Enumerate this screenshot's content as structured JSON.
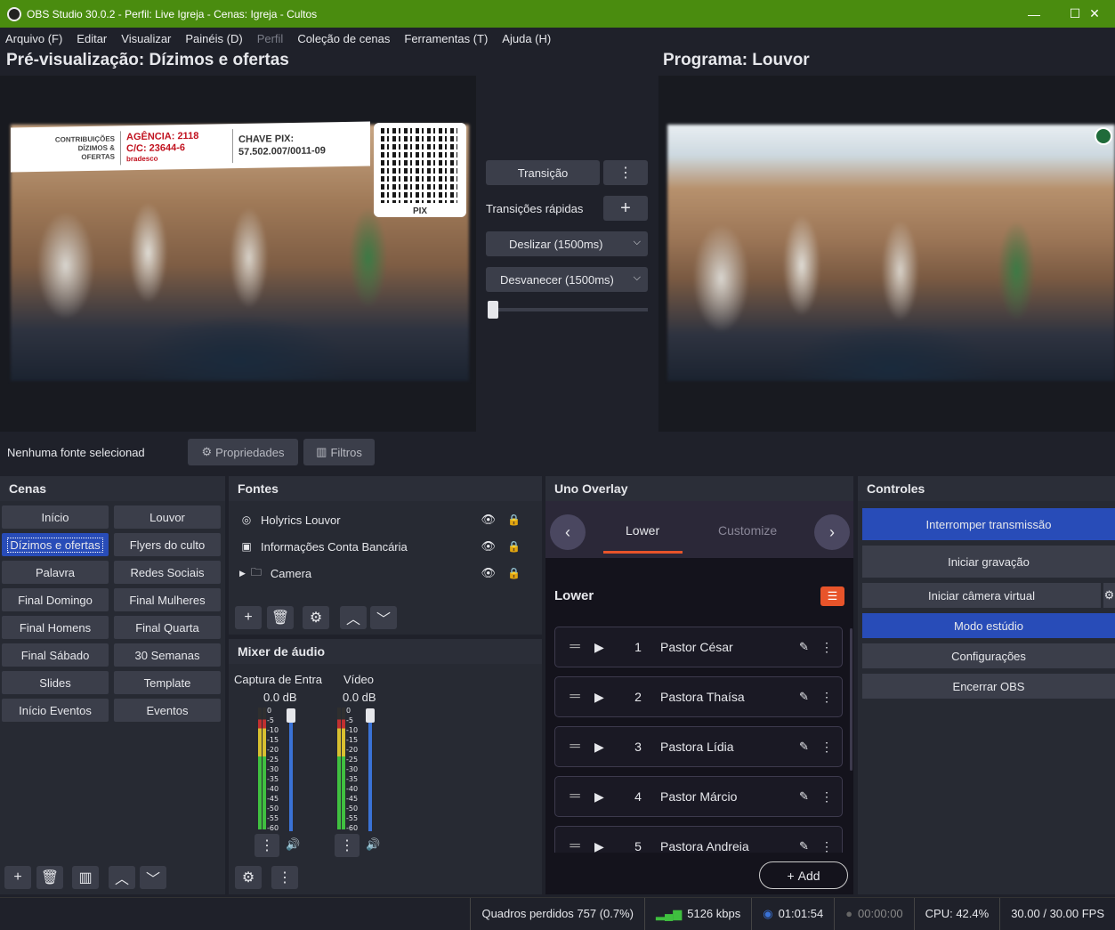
{
  "window": {
    "title": "OBS Studio 30.0.2 - Perfil: Live Igreja - Cenas: Igreja - Cultos"
  },
  "menu": [
    "Arquivo (F)",
    "Editar",
    "Visualizar",
    "Painéis (D)",
    "Perfil",
    "Coleção de cenas",
    "Ferramentas (T)",
    "Ajuda (H)"
  ],
  "preview": {
    "title": "Pré-visualização: Dízimos e ofertas"
  },
  "program": {
    "title": "Programa: Louvor"
  },
  "banner": {
    "contrib": "CONTRIBUIÇÕES",
    "dizimos": "DÍZIMOS &",
    "ofertas": "OFERTAS",
    "agencia": "AGÊNCIA: 2118",
    "cc": "C/C: 23644-6",
    "bank": "bradesco",
    "pix_key_label": "CHAVE PIX:",
    "pix_key": "57.502.007/0011-09",
    "pix": "PIX"
  },
  "transitions": {
    "transition_btn": "Transição",
    "quick_label": "Transições rápidas",
    "quick1": "Deslizar (1500ms)",
    "quick2": "Desvanecer (1500ms)"
  },
  "source_toolbar": {
    "no_source": "Nenhuma fonte selecionad",
    "properties": "Propriedades",
    "filters": "Filtros"
  },
  "scenes": {
    "title": "Cenas",
    "items": [
      "Início",
      "Louvor",
      "Dízimos e ofertas",
      "Flyers do culto",
      "Palavra",
      "Redes Sociais",
      "Final Domingo",
      "Final Mulheres",
      "Final Homens",
      "Final Quarta",
      "Final Sábado",
      "30 Semanas",
      "Slides",
      "Template",
      "Início Eventos",
      "Eventos"
    ],
    "selected": "Dízimos e ofertas"
  },
  "sources": {
    "title": "Fontes",
    "items": [
      "Holyrics Louvor",
      "Informações Conta Bancária",
      "Camera"
    ]
  },
  "mixer": {
    "title": "Mixer de áudio",
    "channels": [
      {
        "name": "Captura de Entra",
        "db": "0.0 dB"
      },
      {
        "name": "Vídeo",
        "db": "0.0 dB"
      }
    ],
    "scale": [
      "0",
      "-5",
      "-10",
      "-15",
      "-20",
      "-25",
      "-30",
      "-35",
      "-40",
      "-45",
      "-50",
      "-55",
      "-60"
    ]
  },
  "uno": {
    "title": "Uno Overlay",
    "tab_active": "Lower",
    "tab_other": "Customize",
    "section": "Lower",
    "items": [
      {
        "num": "1",
        "name": "Pastor César"
      },
      {
        "num": "2",
        "name": "Pastora Thaísa"
      },
      {
        "num": "3",
        "name": "Pastora Lídia"
      },
      {
        "num": "4",
        "name": "Pastor Márcio"
      },
      {
        "num": "5",
        "name": "Pastora Andreia"
      }
    ],
    "add": "Add",
    "accent": "#e8542a"
  },
  "controls": {
    "title": "Controles",
    "stop_stream": "Interromper transmissão",
    "start_rec": "Iniciar gravação",
    "virtual_cam": "Iniciar câmera virtual",
    "studio": "Modo estúdio",
    "settings": "Configurações",
    "exit": "Encerrar OBS"
  },
  "status": {
    "dropped": "Quadros perdidos 757 (0.7%)",
    "kbps": "5126 kbps",
    "live_time": "01:01:54",
    "rec_time": "00:00:00",
    "cpu": "CPU: 42.4%",
    "fps": "30.00 / 30.00 FPS"
  }
}
